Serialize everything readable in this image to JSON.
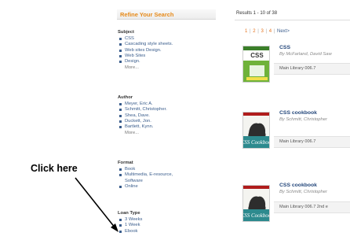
{
  "sidebar": {
    "title": "Refine Your Search",
    "facets": [
      {
        "heading": "Subject",
        "items": [
          "CSS",
          "Cascading style sheets.",
          "Web sites Design.",
          "Web Sites",
          "Design."
        ],
        "more": "More..."
      },
      {
        "heading": "Author",
        "items": [
          "Meyer, Eric A.",
          "Schmitt, Christopher.",
          "Shea, Dave.",
          "Duckett, Jon.",
          "Bartlett, Kynn."
        ],
        "more": "More..."
      },
      {
        "heading": "Format",
        "items": [
          "Book",
          "Multimedia, E-resource,",
          "Software",
          "Online"
        ]
      },
      {
        "heading": "Loan Type",
        "items": [
          "3 Weeks",
          "1 Week",
          "Ebook"
        ]
      }
    ]
  },
  "results": {
    "summary": "Results 1 - 10 of 38",
    "pagination": {
      "pages": [
        "1",
        "2",
        "3",
        "4"
      ],
      "next": "Next>",
      "current": "1"
    },
    "items": [
      {
        "title": "CSS",
        "author": "By McFarland, David Saw",
        "holdings": "Main Library 006.7",
        "cover": "CSS",
        "cover_color": "#6fb23a"
      },
      {
        "title": "CSS cookbook",
        "author": "By Schmitt, Christopher",
        "holdings": "Main Library 006.7",
        "cover": "CSS Cookbook",
        "cover_color": "#2d8a8e"
      },
      {
        "title": "CSS cookbook",
        "author": "By Schmitt, Christopher",
        "holdings": "Main Library 006.7 2nd e",
        "cover": "CSS Cookbook",
        "cover_color": "#2d8a8e"
      }
    ]
  },
  "annotation": {
    "label": "Click here"
  },
  "colors": {
    "accent": "#e68a1a",
    "link": "#3a5d8c",
    "title": "#23467a"
  }
}
